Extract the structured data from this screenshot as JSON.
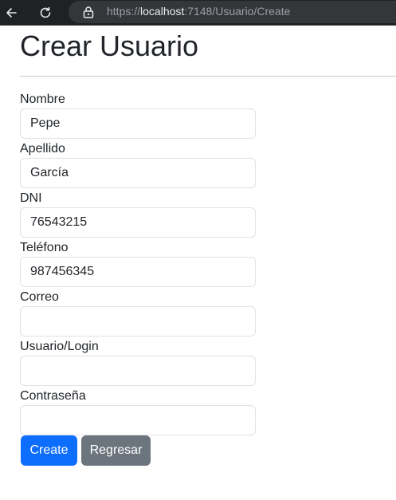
{
  "browser": {
    "url_scheme": "https://",
    "url_host": "localhost",
    "url_path": ":7148/Usuario/Create"
  },
  "page": {
    "title": "Crear Usuario"
  },
  "form": {
    "nombre": {
      "label": "Nombre",
      "value": "Pepe"
    },
    "apellido": {
      "label": "Apellido",
      "value": "García"
    },
    "dni": {
      "label": "DNI",
      "value": "76543215"
    },
    "telefono": {
      "label": "Teléfono",
      "value": "987456345"
    },
    "correo": {
      "label": "Correo",
      "value": ""
    },
    "usuario": {
      "label": "Usuario/Login",
      "value": ""
    },
    "contrasena": {
      "label": "Contraseña",
      "value": ""
    }
  },
  "actions": {
    "create_label": "Create",
    "back_label": "Regresar"
  },
  "colors": {
    "primary": "#0d6efd",
    "secondary": "#6c757d",
    "chrome_bg": "#202124"
  }
}
